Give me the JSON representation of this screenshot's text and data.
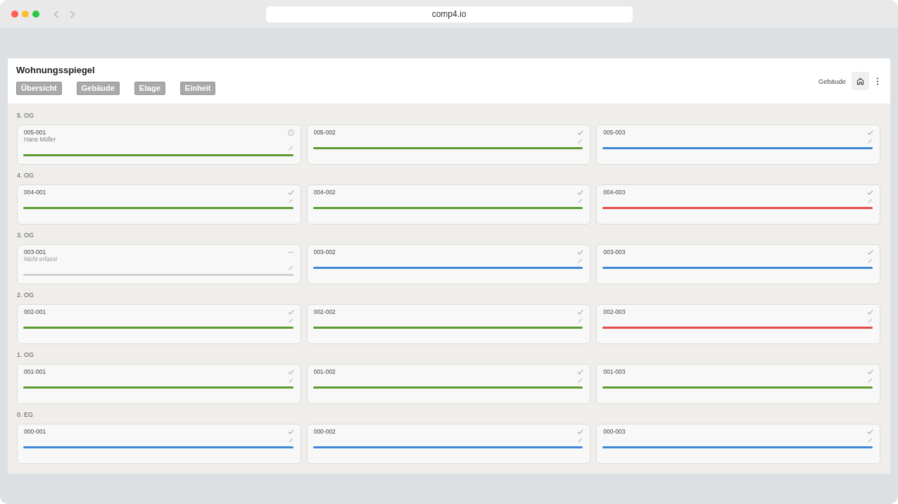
{
  "browser": {
    "url": "comp4.io"
  },
  "header": {
    "title": "Wohnungsspiegel",
    "nav_buttons": [
      "Übersicht",
      "Gebäude",
      "Etage",
      "Einheit"
    ],
    "context_label": "Gebäude"
  },
  "floors": [
    {
      "label": "5. OG",
      "units": [
        {
          "label": "005-001",
          "kind": "info",
          "tenant": "Hans Müller",
          "color": "#5b9a2c"
        },
        {
          "label": "005-002",
          "kind": "check",
          "color": "#5b9a2c"
        },
        {
          "label": "005-003",
          "kind": "check",
          "color": "#3d87d6"
        }
      ]
    },
    {
      "label": "4. OG",
      "units": [
        {
          "label": "004-001",
          "kind": "check",
          "color": "#5b9a2c"
        },
        {
          "label": "004-002",
          "kind": "check",
          "color": "#5b9a2c"
        },
        {
          "label": "004-003",
          "kind": "check",
          "color": "#e04a4a"
        }
      ]
    },
    {
      "label": "3. OG",
      "units": [
        {
          "label": "003-001",
          "kind": "dash",
          "note": "Nicht erfasst",
          "color": "#d0d0ce"
        },
        {
          "label": "003-002",
          "kind": "check",
          "color": "#3d87d6"
        },
        {
          "label": "003-003",
          "kind": "check",
          "color": "#3d87d6"
        }
      ]
    },
    {
      "label": "2. OG",
      "units": [
        {
          "label": "002-001",
          "kind": "check",
          "color": "#5b9a2c"
        },
        {
          "label": "002-002",
          "kind": "check",
          "color": "#5b9a2c"
        },
        {
          "label": "002-003",
          "kind": "check",
          "color": "#e04a4a"
        }
      ]
    },
    {
      "label": "1. OG",
      "units": [
        {
          "label": "001-001",
          "kind": "check",
          "color": "#5b9a2c"
        },
        {
          "label": "001-002",
          "kind": "check",
          "color": "#5b9a2c"
        },
        {
          "label": "001-003",
          "kind": "check",
          "color": "#5b9a2c"
        }
      ]
    },
    {
      "label": "0. EG",
      "units": [
        {
          "label": "000-001",
          "kind": "check",
          "color": "#3d87d6"
        },
        {
          "label": "000-002",
          "kind": "check",
          "color": "#3d87d6"
        },
        {
          "label": "000-003",
          "kind": "check",
          "color": "#3d87d6"
        }
      ]
    }
  ]
}
